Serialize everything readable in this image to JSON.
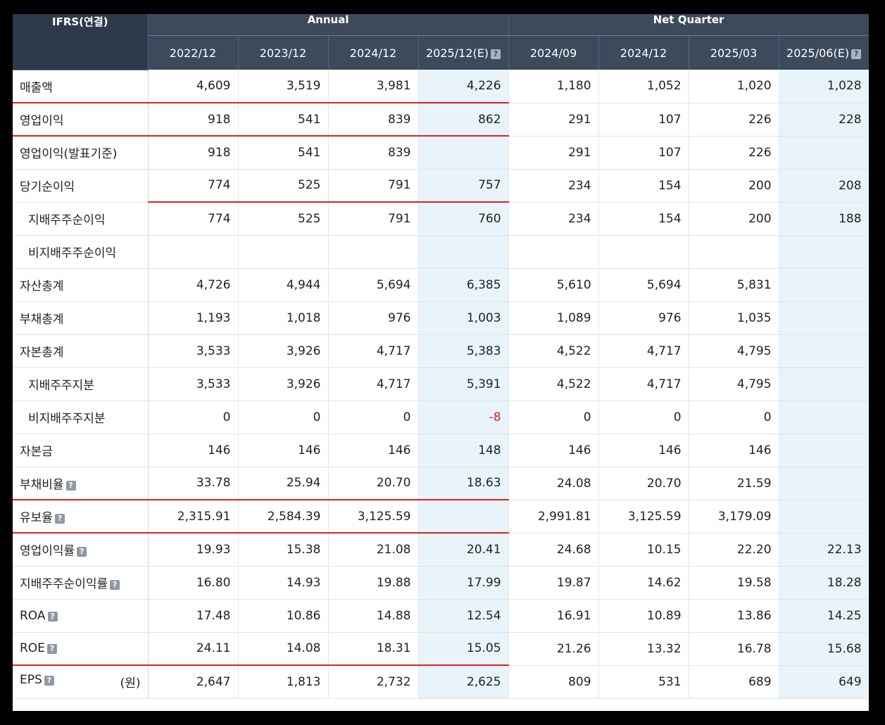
{
  "header": {
    "corner_label": "IFRS(연결)",
    "annual_label": "Annual",
    "quarter_label": "Net Quarter",
    "periods": [
      "2022/12",
      "2023/12",
      "2024/12",
      "2025/12(E)",
      "2024/09",
      "2024/12",
      "2025/03",
      "2025/06(E)"
    ],
    "estimate_columns": [
      3,
      7
    ]
  },
  "rows": [
    {
      "label": "매출액",
      "values": [
        "4,609",
        "3,519",
        "3,981",
        "4,226",
        "1,180",
        "1,052",
        "1,020",
        "1,028"
      ]
    },
    {
      "label": "영업이익",
      "values": [
        "918",
        "541",
        "839",
        "862",
        "291",
        "107",
        "226",
        "228"
      ]
    },
    {
      "label": "영업이익(발표기준)",
      "values": [
        "918",
        "541",
        "839",
        "",
        "291",
        "107",
        "226",
        ""
      ]
    },
    {
      "label": "당기순이익",
      "values": [
        "774",
        "525",
        "791",
        "757",
        "234",
        "154",
        "200",
        "208"
      ]
    },
    {
      "label": "지배주주순이익",
      "values": [
        "774",
        "525",
        "791",
        "760",
        "234",
        "154",
        "200",
        "188"
      ]
    },
    {
      "label": "비지배주주순이익",
      "values": [
        "",
        "",
        "",
        "",
        "",
        "",
        "",
        ""
      ]
    },
    {
      "label": "자산총계",
      "values": [
        "4,726",
        "4,944",
        "5,694",
        "6,385",
        "5,610",
        "5,694",
        "5,831",
        ""
      ]
    },
    {
      "label": "부채총계",
      "values": [
        "1,193",
        "1,018",
        "976",
        "1,003",
        "1,089",
        "976",
        "1,035",
        ""
      ]
    },
    {
      "label": "자본총계",
      "values": [
        "3,533",
        "3,926",
        "4,717",
        "5,383",
        "4,522",
        "4,717",
        "4,795",
        ""
      ]
    },
    {
      "label": "지배주주지분",
      "values": [
        "3,533",
        "3,926",
        "4,717",
        "5,391",
        "4,522",
        "4,717",
        "4,795",
        ""
      ]
    },
    {
      "label": "비지배주주지분",
      "values": [
        "0",
        "0",
        "0",
        "-8",
        "0",
        "0",
        "0",
        ""
      ]
    },
    {
      "label": "자본금",
      "values": [
        "146",
        "146",
        "146",
        "148",
        "146",
        "146",
        "146",
        ""
      ]
    },
    {
      "label": "부채비율",
      "values": [
        "33.78",
        "25.94",
        "20.70",
        "18.63",
        "24.08",
        "20.70",
        "21.59",
        ""
      ]
    },
    {
      "label": "유보율",
      "values": [
        "2,315.91",
        "2,584.39",
        "3,125.59",
        "",
        "2,991.81",
        "3,125.59",
        "3,179.09",
        ""
      ]
    },
    {
      "label": "영업이익률",
      "values": [
        "19.93",
        "15.38",
        "21.08",
        "20.41",
        "24.68",
        "10.15",
        "22.20",
        "22.13"
      ]
    },
    {
      "label": "지배주주순이익률",
      "values": [
        "16.80",
        "14.93",
        "19.88",
        "17.99",
        "19.87",
        "14.62",
        "19.58",
        "18.28"
      ]
    },
    {
      "label": "ROA",
      "values": [
        "17.48",
        "10.86",
        "14.88",
        "12.54",
        "16.91",
        "10.89",
        "13.86",
        "14.25"
      ]
    },
    {
      "label": "ROE",
      "values": [
        "24.11",
        "14.08",
        "18.31",
        "15.05",
        "21.26",
        "13.32",
        "16.78",
        "15.68"
      ]
    },
    {
      "label": "EPS",
      "unit": "(원)",
      "values": [
        "2,647",
        "1,813",
        "2,732",
        "2,625",
        "809",
        "531",
        "689",
        "649"
      ]
    }
  ],
  "help_icon_glyph": "?",
  "colors": {
    "header_bg": "#3c4a5c",
    "estimate_bg": "#e8f4fa",
    "highlight_line": "#e02020",
    "negative_text": "#e02020"
  }
}
